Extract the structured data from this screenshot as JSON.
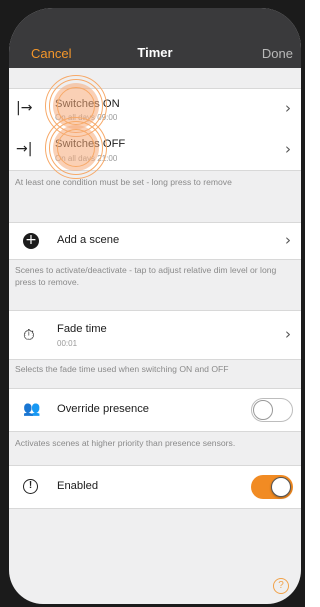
{
  "nav": {
    "cancel": "Cancel",
    "title": "Timer",
    "done": "Done"
  },
  "conditions": [
    {
      "icon": "|→",
      "title": "Switches ON",
      "subtitle": "On all days 09:00"
    },
    {
      "icon": "→|",
      "title": "Switches OFF",
      "subtitle": "On all days 21:00"
    }
  ],
  "conditions_caption": "At least one condition must be set - long press to remove",
  "scene": {
    "label": "Add a scene",
    "caption": "Scenes to activate/deactivate - tap to adjust relative dim level or long press to remove."
  },
  "fade": {
    "label": "Fade time",
    "value": "00:01",
    "caption": "Selects the fade time used when switching ON and OFF"
  },
  "presence": {
    "label": "Override presence",
    "state": "off",
    "caption": "Activates scenes at higher priority than presence sensors."
  },
  "enabled": {
    "label": "Enabled",
    "state": "on"
  },
  "chevron": "›",
  "help": "?",
  "colors": {
    "accent": "#f4962a",
    "navbar": "#3a3a3c",
    "background": "#efeff0"
  }
}
